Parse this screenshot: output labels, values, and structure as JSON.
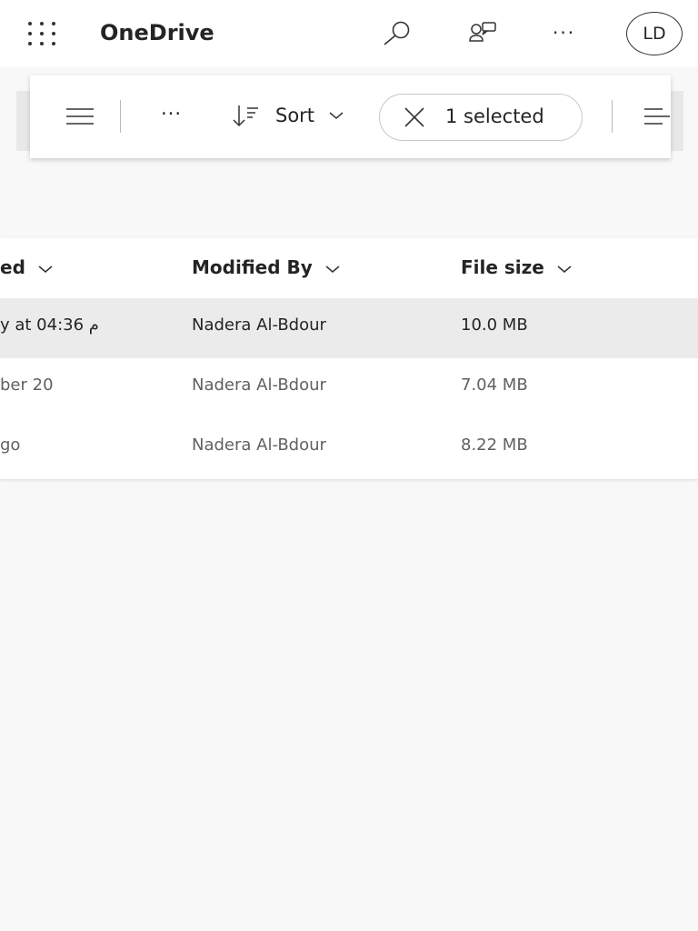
{
  "header": {
    "app_title": "OneDrive",
    "avatar_initials": "LD"
  },
  "toolbar": {
    "sort_label": "Sort",
    "selection_label": "1 selected"
  },
  "table": {
    "columns": [
      "ed",
      "Modified By",
      "File size"
    ],
    "rows": [
      {
        "modified": "y at 04:36 م",
        "modified_by": "Nadera Al-Bdour",
        "file_size": "10.0 MB",
        "selected": true
      },
      {
        "modified": "ber 20",
        "modified_by": "Nadera Al-Bdour",
        "file_size": "7.04 MB",
        "selected": false
      },
      {
        "modified": "go",
        "modified_by": "Nadera Al-Bdour",
        "file_size": "8.22 MB",
        "selected": false
      }
    ]
  }
}
